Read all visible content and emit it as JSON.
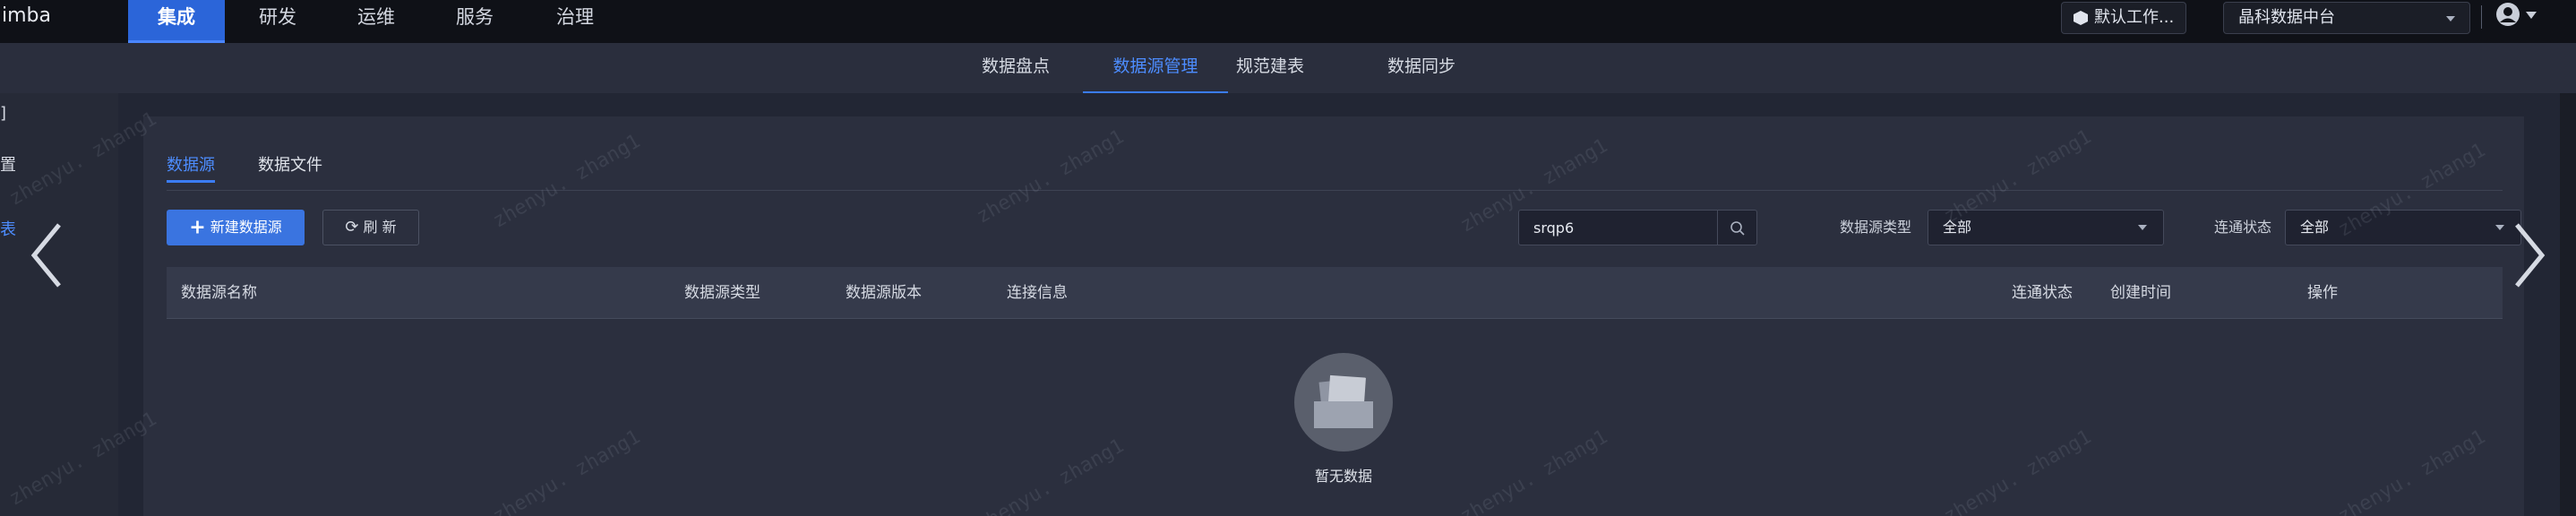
{
  "brand": "imba",
  "top_nav": [
    {
      "label": "集成",
      "active": true
    },
    {
      "label": "研发",
      "active": false
    },
    {
      "label": "运维",
      "active": false
    },
    {
      "label": "服务",
      "active": false
    },
    {
      "label": "治理",
      "active": false
    }
  ],
  "workspace": {
    "label": "默认工作..."
  },
  "platform": {
    "label": "晶科数据中台"
  },
  "sub_nav": [
    {
      "label": "数据盘点",
      "active": false
    },
    {
      "label": "数据源管理",
      "active": true
    },
    {
      "label": "规范建表",
      "active": false
    },
    {
      "label": "数据同步",
      "active": false
    }
  ],
  "sidebar": {
    "items": [
      "]",
      "置",
      "表"
    ]
  },
  "tabs": [
    {
      "label": "数据源",
      "active": true
    },
    {
      "label": "数据文件",
      "active": false
    }
  ],
  "toolbar": {
    "new_button": "新建数据源",
    "refresh_button": "刷 新",
    "search_value": "srqp6",
    "type_filter_label": "数据源类型",
    "type_filter_value": "全部",
    "status_filter_label": "连通状态",
    "status_filter_value": "全部"
  },
  "table": {
    "columns": [
      "数据源名称",
      "数据源类型",
      "数据源版本",
      "连接信息",
      "连通状态",
      "创建时间",
      "操作"
    ],
    "rows": [],
    "empty_text": "暂无数据"
  },
  "watermark": "zhenyu. zhang1",
  "colors": {
    "accent": "#3b7cf5",
    "topbar": "#0f1117",
    "background": "#222634"
  },
  "icons": {
    "carousel_prev": "chevron-left-icon",
    "carousel_next": "chevron-right-icon"
  }
}
